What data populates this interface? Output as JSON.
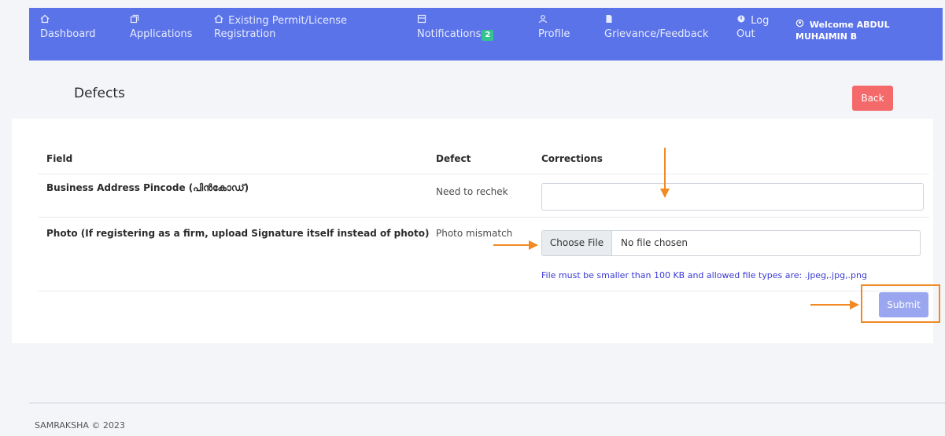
{
  "nav": {
    "items": [
      {
        "label": "Dashboard",
        "icon": "home-icon"
      },
      {
        "label": "Applications",
        "icon": "copy-icon"
      },
      {
        "label_line1": "Existing Permit/License",
        "label_line2": "Registration",
        "icon": "home-icon"
      },
      {
        "label": "Notifications",
        "badge": "2",
        "icon": "calendar-icon"
      },
      {
        "label": "Profile",
        "icon": "user-icon"
      },
      {
        "label": "Grievance/Feedback",
        "icon": "file-icon"
      },
      {
        "label_line1": "Log",
        "label_line2": "Out",
        "icon": "power-icon"
      }
    ],
    "welcome_line1": "Welcome ABDUL",
    "welcome_line2": "MUHAIMIN B"
  },
  "page": {
    "title": "Defects",
    "back_label": "Back"
  },
  "table": {
    "headers": {
      "field": "Field",
      "defect": "Defect",
      "corrections": "Corrections"
    },
    "rows": [
      {
        "field": "Business Address Pincode (പിൻകോഡ്)",
        "defect": "Need to rechek",
        "correction_value": ""
      },
      {
        "field": "Photo (If registering as a firm, upload Signature itself instead of photo)",
        "defect": "Photo mismatch",
        "file_button": "Choose File",
        "file_status": "No file chosen",
        "hint": "File must be smaller than 100 KB and allowed file types are: .jpeg,.jpg,.png"
      }
    ]
  },
  "submit_label": "Submit",
  "footer": "SAMRAKSHA © 2023",
  "colors": {
    "nav": "#5b73e8",
    "back": "#f46a6a",
    "submit": "#9aa6f0",
    "annotation": "#f08a24",
    "badge": "#34c38f"
  }
}
